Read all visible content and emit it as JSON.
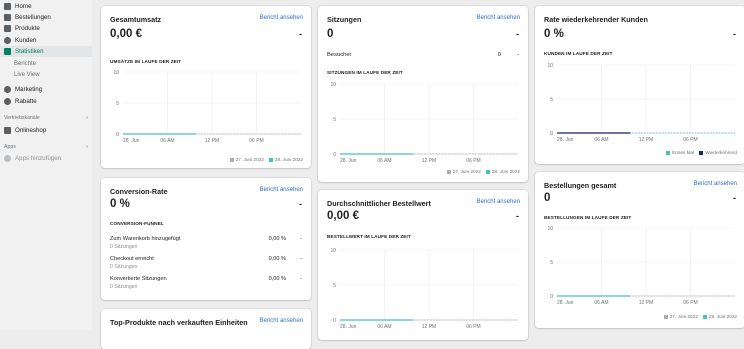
{
  "sidebar": {
    "items": [
      {
        "label": "Home",
        "icon": "home-icon"
      },
      {
        "label": "Bestellungen",
        "icon": "orders-icon"
      },
      {
        "label": "Produkte",
        "icon": "products-icon"
      },
      {
        "label": "Kunden",
        "icon": "customers-icon"
      },
      {
        "label": "Statistiken",
        "icon": "analytics-icon"
      },
      {
        "label": "Berichte"
      },
      {
        "label": "Live View"
      },
      {
        "label": "Marketing",
        "icon": "marketing-icon"
      },
      {
        "label": "Rabatte",
        "icon": "discounts-icon"
      }
    ],
    "channels_label": "Vertriebskanäle",
    "onlineshop": "Onlineshop",
    "apps_label": "Apps",
    "add_apps": "Apps hinzufügen",
    "active_color": "#008060"
  },
  "common": {
    "link": "Bericht ansehen",
    "dash": "-",
    "legend_a": "27. Juni 2022",
    "legend_b": "28. Juni 2022"
  },
  "gesamtumsatz": {
    "title": "Gesamtumsatz",
    "value": "0,00 €",
    "caption": "UMSÄTZE IM LAUFE DER ZEIT",
    "chart_data": {
      "type": "line",
      "x": [
        "28. Jun",
        "06 AM",
        "12 PM",
        "06 PM"
      ],
      "ylim": [
        0,
        10
      ],
      "yticks": [
        "10",
        "5",
        "0"
      ],
      "series": [
        {
          "name": "27. Juni 2022",
          "values": [
            0,
            0,
            0,
            0
          ],
          "color": "#a8aeb5"
        },
        {
          "name": "28. Juni 2022",
          "values": [
            0,
            0,
            0,
            0
          ],
          "color": "#47c1bf"
        }
      ]
    }
  },
  "conversion": {
    "title": "Conversion-Rate",
    "value": "0 %",
    "caption": "CONVERSION-FUNNEL",
    "rows": [
      {
        "label": "Zum Warenkorb hinzugefügt",
        "sub": "0 Sitzungen",
        "value": "0,00 %",
        "dash": "-"
      },
      {
        "label": "Checkout erreicht",
        "sub": "0 Sitzungen",
        "value": "0,00 %",
        "dash": "-"
      },
      {
        "label": "Konvertierte Sitzungen",
        "sub": "0 Sitzungen",
        "value": "0,00 %",
        "dash": "-"
      }
    ]
  },
  "topprodukte": {
    "title": "Top-Produkte nach verkauften Einheiten"
  },
  "sitzungen": {
    "title": "Sitzungen",
    "value": "0",
    "besucher_label": "Besucher",
    "besucher_value": "0",
    "caption": "SITZUNGEN IM LAUFE DER ZEIT",
    "chart_data": {
      "type": "line",
      "x": [
        "28. Jun",
        "06 AM",
        "12 PM",
        "06 PM"
      ],
      "ylim": [
        0,
        10
      ],
      "yticks": [
        "10",
        "5",
        "0"
      ],
      "series": [
        {
          "name": "27. Juni 2022",
          "values": [
            0,
            0,
            0,
            0
          ],
          "color": "#a8aeb5"
        },
        {
          "name": "28. Juni 2022",
          "values": [
            0,
            0,
            0,
            0
          ],
          "color": "#47c1bf"
        }
      ]
    }
  },
  "bestellwert": {
    "title": "Durchschnittlicher Bestellwert",
    "value": "0,00 €",
    "caption": "BESTELLWERT IM LAUFE DER ZEIT",
    "chart_data": {
      "type": "line",
      "x": [
        "28. Jun",
        "06 AM",
        "12 PM",
        "06 PM"
      ],
      "ylim": [
        0,
        10
      ],
      "yticks": [
        "10",
        "5",
        "0"
      ],
      "series": [
        {
          "name": "27. Juni 2022",
          "values": [
            0,
            0,
            0,
            0
          ],
          "color": "#a8aeb5"
        },
        {
          "name": "28. Juni 2022",
          "values": [
            0,
            0,
            0,
            0
          ],
          "color": "#47c1bf"
        }
      ]
    }
  },
  "wiederkehrend": {
    "title": "Rate wiederkehrender Kunden",
    "value": "0 %",
    "caption": "KUNDEN IM LAUFE DER ZEIT",
    "legend_a": "Erstes Mal",
    "legend_b": "Wiederkehrend",
    "chart_data": {
      "type": "line",
      "x": [
        "28. Jun",
        "06 AM",
        "12 PM",
        "06 PM"
      ],
      "ylim": [
        0,
        10
      ],
      "yticks": [
        "10",
        "5",
        "0"
      ],
      "series": [
        {
          "name": "Erstes Mal",
          "values": [
            0,
            0,
            0,
            0
          ],
          "color": "#47c1bf"
        },
        {
          "name": "Wiederkehrend",
          "values": [
            0,
            0,
            0,
            0
          ],
          "color": "#1c2260"
        }
      ]
    }
  },
  "bestellungen": {
    "title": "Bestellungen gesamt",
    "value": "0",
    "caption": "BESTELLUNGEN IM LAUFE DER ZEIT",
    "chart_data": {
      "type": "line",
      "x": [
        "28. Jun",
        "06 AM",
        "12 PM",
        "06 PM"
      ],
      "ylim": [
        0,
        10
      ],
      "yticks": [
        "10",
        "5",
        "0"
      ],
      "series": [
        {
          "name": "27. Juni 2022",
          "values": [
            0,
            0,
            0,
            0
          ],
          "color": "#a8aeb5"
        },
        {
          "name": "28. Juni 2022",
          "values": [
            0,
            0,
            0,
            0
          ],
          "color": "#47c1bf"
        }
      ]
    }
  }
}
